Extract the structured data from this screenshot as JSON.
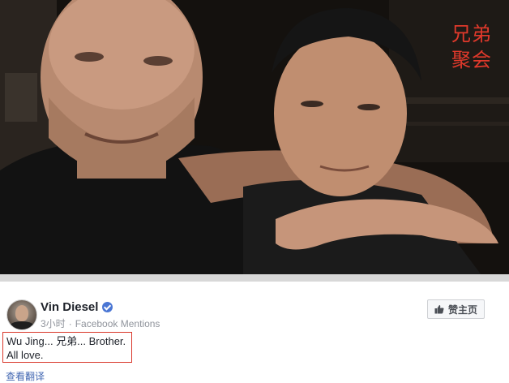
{
  "overlay": {
    "line1": "兄弟",
    "line2": "聚会"
  },
  "post": {
    "author": "Vin Diesel",
    "time": "3小时",
    "separator": "·",
    "source": "Facebook Mentions",
    "text_line1": "Wu Jing... 兄弟... Brother.",
    "text_line2": "All love.",
    "see_translation": "查看翻译"
  },
  "like_page": {
    "label": "赞主页"
  },
  "colors": {
    "overlay_text": "#e0392b",
    "highlight_border": "#d9372a",
    "link": "#4267b2",
    "verified": "#4a76d4"
  }
}
